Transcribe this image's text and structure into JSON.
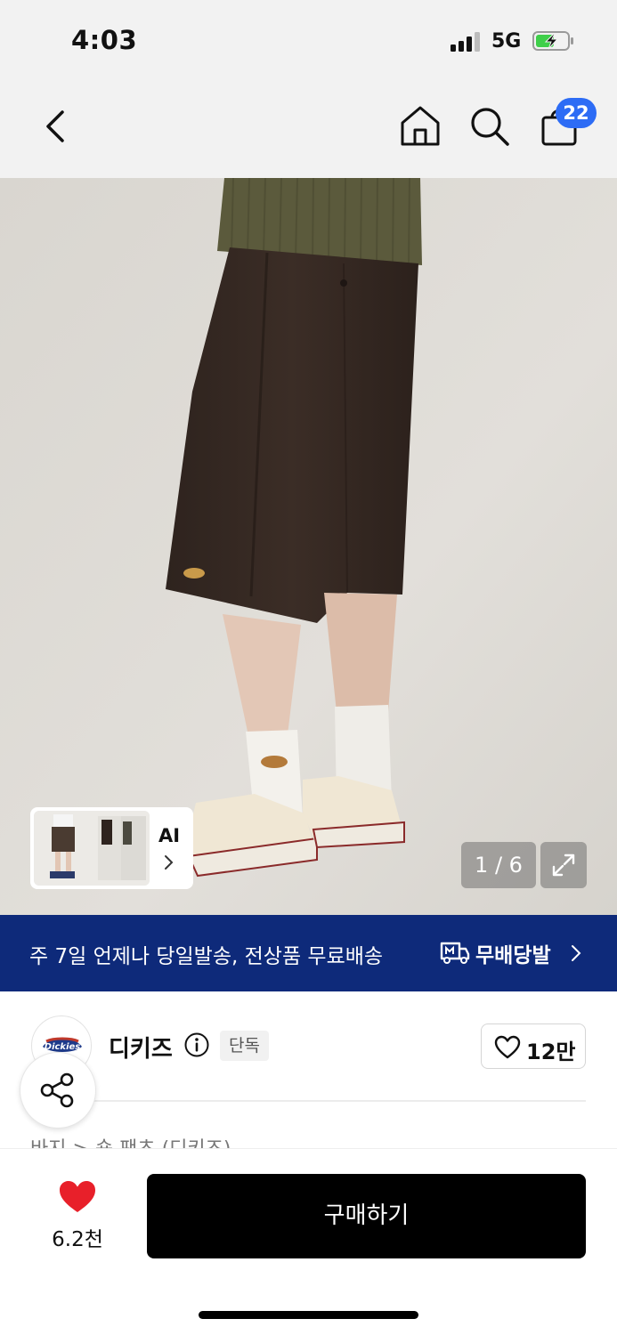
{
  "status_bar": {
    "time": "4:03",
    "network": "5G",
    "signal_icon": "signal-bars-icon",
    "battery_icon": "battery-charging-icon"
  },
  "nav": {
    "back_icon": "chevron-left-icon",
    "home_icon": "home-icon",
    "search_icon": "search-icon",
    "cart_icon": "shopping-bag-icon",
    "cart_count": "22",
    "badge_color": "#2d6cf5"
  },
  "gallery": {
    "ai_label": "AI",
    "counter": "1 / 6",
    "expand_icon": "expand-arrows-icon"
  },
  "promo": {
    "text": "주 7일 언제나 당일발송, 전상품 무료배송",
    "brand": "무배당발",
    "background": "#0e2a7a"
  },
  "brand": {
    "name": "디키즈",
    "badge": "단독",
    "follow_count": "12만",
    "logo_text": "Dickies"
  },
  "breadcrumb": "바지 > 숏 팬츠 (디키즈)",
  "bottom": {
    "like_count": "6.2천",
    "like_color": "#e8202a",
    "buy_label": "구매하기"
  }
}
